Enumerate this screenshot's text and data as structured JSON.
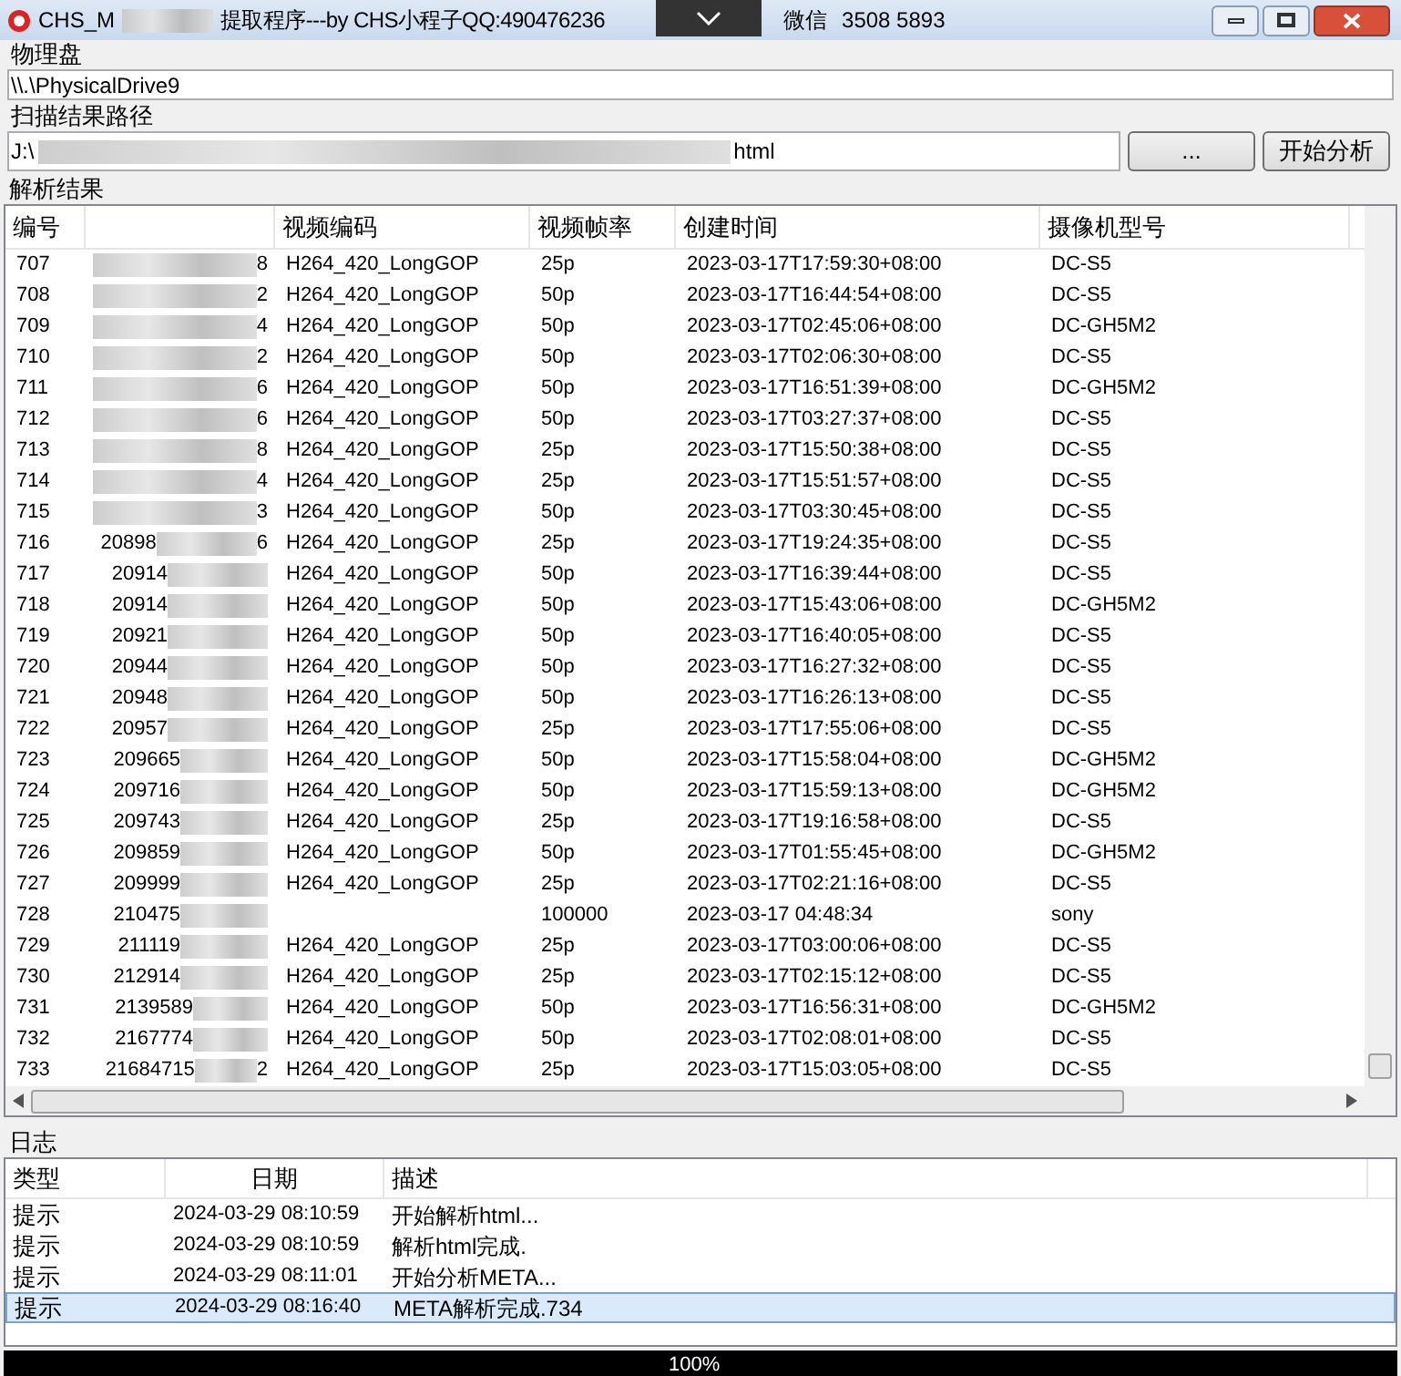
{
  "window": {
    "title_start": "CHS_M",
    "title_middle": "提取程序---by CHS小程子QQ:490476236",
    "title_wechat": "微信",
    "title_end": "3508 5893"
  },
  "drive": {
    "label": "物理盘",
    "value": "\\\\.\\PhysicalDrive9"
  },
  "path": {
    "label": "扫描结果路径",
    "value_start": "J:\\",
    "value_end": "html"
  },
  "buttons": [
    "...",
    "开始分析"
  ],
  "results": {
    "label": "解析结果",
    "columns": [
      "编号",
      "",
      "视频编码",
      "视频帧率",
      "创建时间",
      "摄像机型号"
    ],
    "rows": [
      {
        "no": "707",
        "id_start": "",
        "id_end": "8",
        "codec": "H264_420_LongGOP",
        "fps": "25p",
        "created": "2023-03-17T17:59:30+08:00",
        "camera": "DC-S5"
      },
      {
        "no": "708",
        "id_start": "",
        "id_end": "2",
        "codec": "H264_420_LongGOP",
        "fps": "50p",
        "created": "2023-03-17T16:44:54+08:00",
        "camera": "DC-S5"
      },
      {
        "no": "709",
        "id_start": "",
        "id_end": "4",
        "codec": "H264_420_LongGOP",
        "fps": "50p",
        "created": "2023-03-17T02:45:06+08:00",
        "camera": "DC-GH5M2"
      },
      {
        "no": "710",
        "id_start": "",
        "id_end": "2",
        "codec": "H264_420_LongGOP",
        "fps": "50p",
        "created": "2023-03-17T02:06:30+08:00",
        "camera": "DC-S5"
      },
      {
        "no": "711",
        "id_start": "",
        "id_end": "6",
        "codec": "H264_420_LongGOP",
        "fps": "50p",
        "created": "2023-03-17T16:51:39+08:00",
        "camera": "DC-GH5M2"
      },
      {
        "no": "712",
        "id_start": "",
        "id_end": "6",
        "codec": "H264_420_LongGOP",
        "fps": "50p",
        "created": "2023-03-17T03:27:37+08:00",
        "camera": "DC-S5"
      },
      {
        "no": "713",
        "id_start": "",
        "id_end": "8",
        "codec": "H264_420_LongGOP",
        "fps": "25p",
        "created": "2023-03-17T15:50:38+08:00",
        "camera": "DC-S5"
      },
      {
        "no": "714",
        "id_start": "",
        "id_end": "4",
        "codec": "H264_420_LongGOP",
        "fps": "25p",
        "created": "2023-03-17T15:51:57+08:00",
        "camera": "DC-S5"
      },
      {
        "no": "715",
        "id_start": "",
        "id_end": "3",
        "codec": "H264_420_LongGOP",
        "fps": "50p",
        "created": "2023-03-17T03:30:45+08:00",
        "camera": "DC-S5"
      },
      {
        "no": "716",
        "id_start": "20898",
        "id_end": "6",
        "codec": "H264_420_LongGOP",
        "fps": "25p",
        "created": "2023-03-17T19:24:35+08:00",
        "camera": "DC-S5"
      },
      {
        "no": "717",
        "id_start": "20914",
        "id_end": "",
        "codec": "H264_420_LongGOP",
        "fps": "50p",
        "created": "2023-03-17T16:39:44+08:00",
        "camera": "DC-S5"
      },
      {
        "no": "718",
        "id_start": "20914",
        "id_end": "",
        "codec": "H264_420_LongGOP",
        "fps": "50p",
        "created": "2023-03-17T15:43:06+08:00",
        "camera": "DC-GH5M2"
      },
      {
        "no": "719",
        "id_start": "20921",
        "id_end": "",
        "codec": "H264_420_LongGOP",
        "fps": "50p",
        "created": "2023-03-17T16:40:05+08:00",
        "camera": "DC-S5"
      },
      {
        "no": "720",
        "id_start": "20944",
        "id_end": "",
        "codec": "H264_420_LongGOP",
        "fps": "50p",
        "created": "2023-03-17T16:27:32+08:00",
        "camera": "DC-S5"
      },
      {
        "no": "721",
        "id_start": "20948",
        "id_end": "",
        "codec": "H264_420_LongGOP",
        "fps": "50p",
        "created": "2023-03-17T16:26:13+08:00",
        "camera": "DC-S5"
      },
      {
        "no": "722",
        "id_start": "20957",
        "id_end": "",
        "codec": "H264_420_LongGOP",
        "fps": "25p",
        "created": "2023-03-17T17:55:06+08:00",
        "camera": "DC-S5"
      },
      {
        "no": "723",
        "id_start": "209665",
        "id_end": "",
        "codec": "H264_420_LongGOP",
        "fps": "50p",
        "created": "2023-03-17T15:58:04+08:00",
        "camera": "DC-GH5M2"
      },
      {
        "no": "724",
        "id_start": "209716",
        "id_end": "",
        "codec": "H264_420_LongGOP",
        "fps": "50p",
        "created": "2023-03-17T15:59:13+08:00",
        "camera": "DC-GH5M2"
      },
      {
        "no": "725",
        "id_start": "209743",
        "id_end": "",
        "codec": "H264_420_LongGOP",
        "fps": "25p",
        "created": "2023-03-17T19:16:58+08:00",
        "camera": "DC-S5"
      },
      {
        "no": "726",
        "id_start": "209859",
        "id_end": "",
        "codec": "H264_420_LongGOP",
        "fps": "50p",
        "created": "2023-03-17T01:55:45+08:00",
        "camera": "DC-GH5M2"
      },
      {
        "no": "727",
        "id_start": "209999",
        "id_end": "",
        "codec": "H264_420_LongGOP",
        "fps": "25p",
        "created": "2023-03-17T02:21:16+08:00",
        "camera": "DC-S5"
      },
      {
        "no": "728",
        "id_start": "210475",
        "id_end": "",
        "codec": "",
        "fps": "100000",
        "created": "2023-03-17 04:48:34",
        "camera": "sony"
      },
      {
        "no": "729",
        "id_start": "211119",
        "id_end": "",
        "codec": "H264_420_LongGOP",
        "fps": "25p",
        "created": "2023-03-17T03:00:06+08:00",
        "camera": "DC-S5"
      },
      {
        "no": "730",
        "id_start": "212914",
        "id_end": "",
        "codec": "H264_420_LongGOP",
        "fps": "25p",
        "created": "2023-03-17T02:15:12+08:00",
        "camera": "DC-S5"
      },
      {
        "no": "731",
        "id_start": "2139589",
        "id_end": "",
        "codec": "H264_420_LongGOP",
        "fps": "50p",
        "created": "2023-03-17T16:56:31+08:00",
        "camera": "DC-GH5M2"
      },
      {
        "no": "732",
        "id_start": "2167774",
        "id_end": "",
        "codec": "H264_420_LongGOP",
        "fps": "50p",
        "created": "2023-03-17T02:08:01+08:00",
        "camera": "DC-S5"
      },
      {
        "no": "733",
        "id_start": "21684715",
        "id_end": "2",
        "codec": "H264_420_LongGOP",
        "fps": "25p",
        "created": "2023-03-17T15:03:05+08:00",
        "camera": "DC-S5"
      }
    ]
  },
  "log": {
    "label": "日志",
    "columns": [
      "类型",
      "日期",
      "描述"
    ],
    "rows": [
      {
        "type": "提示",
        "date": "2024-03-29 08:10:59",
        "desc": "开始解析html...",
        "selected": false
      },
      {
        "type": "提示",
        "date": "2024-03-29 08:10:59",
        "desc": "解析html完成.",
        "selected": false
      },
      {
        "type": "提示",
        "date": "2024-03-29 08:11:01",
        "desc": "开始分析META...",
        "selected": false
      },
      {
        "type": "提示",
        "date": "2024-03-29 08:16:40",
        "desc": "META解析完成.734",
        "selected": true
      }
    ]
  },
  "progress": {
    "text": "100%",
    "level": 1
  }
}
